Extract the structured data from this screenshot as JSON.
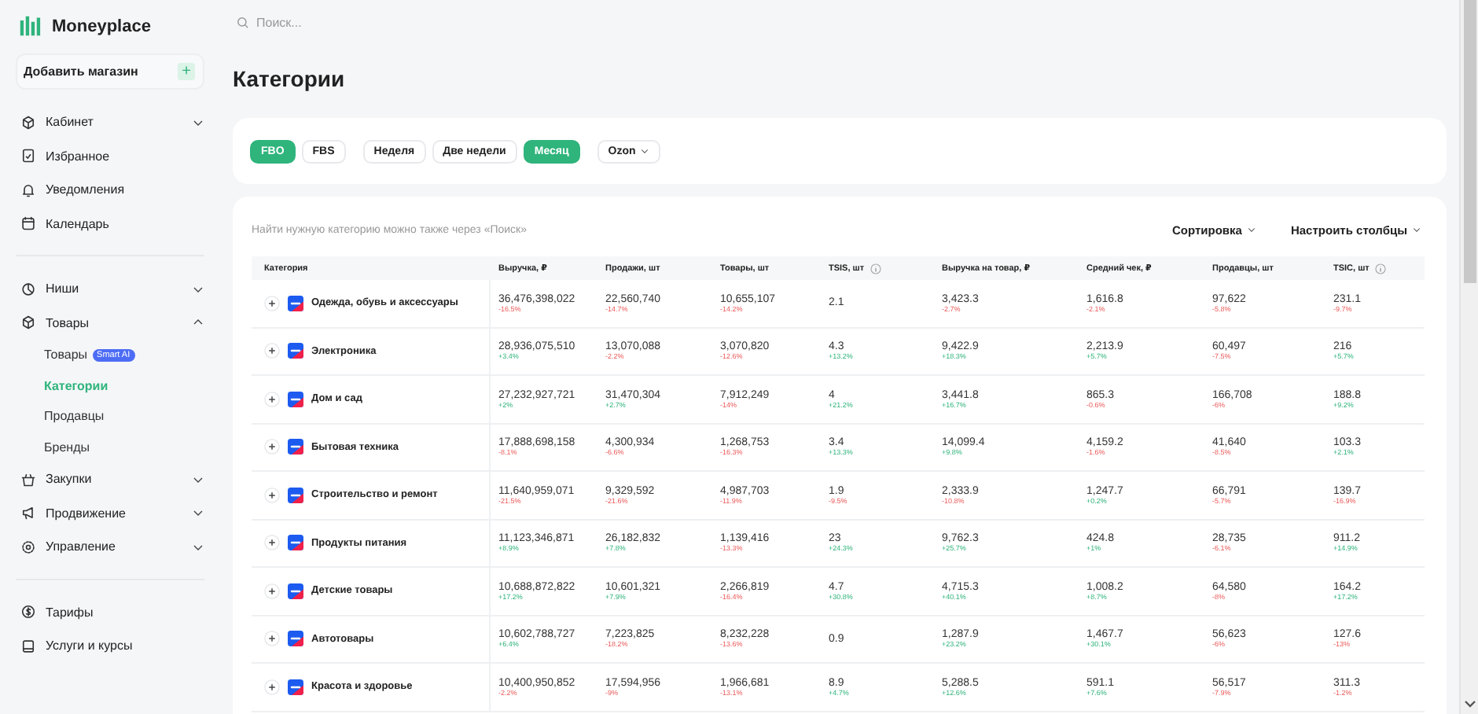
{
  "brand": {
    "name": "Moneyplace"
  },
  "add_store": {
    "label": "Добавить магазин",
    "button": "+"
  },
  "sidebar": {
    "groups": [
      [
        {
          "label": "Кабинет",
          "expanded": false
        },
        {
          "label": "Избранное"
        },
        {
          "label": "Уведомления"
        },
        {
          "label": "Календарь"
        }
      ],
      [
        {
          "label": "Ниши",
          "expanded": false
        },
        {
          "label": "Товары",
          "expanded": true,
          "children": [
            {
              "label": "Товары",
              "badge": "Smart AI",
              "selected": false
            },
            {
              "label": "Категории",
              "selected": true
            },
            {
              "label": "Продавцы",
              "selected": false
            },
            {
              "label": "Бренды",
              "selected": false
            }
          ]
        },
        {
          "label": "Закупки",
          "expanded": false
        },
        {
          "label": "Продвижение",
          "expanded": false
        },
        {
          "label": "Управление",
          "expanded": false
        }
      ],
      [
        {
          "label": "Тарифы"
        },
        {
          "label": "Услуги и курсы"
        }
      ]
    ]
  },
  "search": {
    "placeholder": "Поиск..."
  },
  "page_title": "Категории",
  "filters": [
    {
      "kind": "chip",
      "label": "FBO",
      "selected": true
    },
    {
      "kind": "chip",
      "label": "FBS",
      "selected": false
    },
    {
      "kind": "gap"
    },
    {
      "kind": "chip",
      "label": "Неделя",
      "selected": false
    },
    {
      "kind": "chip",
      "label": "Две недели",
      "selected": false
    },
    {
      "kind": "chip",
      "label": "Месяц",
      "selected": true
    },
    {
      "kind": "gap"
    },
    {
      "kind": "dropdown",
      "label": "Ozon"
    }
  ],
  "hint": "Найти нужную категорию можно также через «Поиск»",
  "toolbar": [
    "Сортировка",
    "Настроить столбцы"
  ],
  "table": {
    "columns": [
      {
        "label": "Категория"
      },
      {
        "label": "Выручка, ₽"
      },
      {
        "label": "Продажи, шт"
      },
      {
        "label": "Товары, шт"
      },
      {
        "label": "TSIS, шт",
        "info": true
      },
      {
        "label": "Выручка на товар, ₽"
      },
      {
        "label": "Средний чек, ₽"
      },
      {
        "label": "Продавцы, шт"
      },
      {
        "label": "TSIC, шт",
        "info": true
      }
    ],
    "rows": [
      {
        "cells": [
          {
            "value": "Одежда, обувь и аксессуары"
          },
          {
            "value": "36,476,398,022",
            "change": "-16.5%",
            "up": false
          },
          {
            "value": "22,560,740",
            "change": "-14.7%",
            "up": false
          },
          {
            "value": "10,655,107",
            "change": "-14.2%",
            "up": false
          },
          {
            "value": "2.1"
          },
          {
            "value": "3,423.3",
            "change": "-2.7%",
            "up": false
          },
          {
            "value": "1,616.8",
            "change": "-2.1%",
            "up": false
          },
          {
            "value": "97,622",
            "change": "-5.8%",
            "up": false
          },
          {
            "value": "231.1",
            "change": "-9.7%",
            "up": false
          }
        ]
      },
      {
        "cells": [
          {
            "value": "Электроника"
          },
          {
            "value": "28,936,075,510",
            "change": "+3.4%",
            "up": true
          },
          {
            "value": "13,070,088",
            "change": "-2.2%",
            "up": false
          },
          {
            "value": "3,070,820",
            "change": "-12.6%",
            "up": false
          },
          {
            "value": "4.3",
            "change": "+13.2%",
            "up": true
          },
          {
            "value": "9,422.9",
            "change": "+18.3%",
            "up": true
          },
          {
            "value": "2,213.9",
            "change": "+5.7%",
            "up": true
          },
          {
            "value": "60,497",
            "change": "-7.5%",
            "up": false
          },
          {
            "value": "216",
            "change": "+5.7%",
            "up": true
          }
        ]
      },
      {
        "cells": [
          {
            "value": "Дом и сад"
          },
          {
            "value": "27,232,927,721",
            "change": "+2%",
            "up": true
          },
          {
            "value": "31,470,304",
            "change": "+2.7%",
            "up": true
          },
          {
            "value": "7,912,249",
            "change": "-14%",
            "up": false
          },
          {
            "value": "4",
            "change": "+21.2%",
            "up": true
          },
          {
            "value": "3,441.8",
            "change": "+16.7%",
            "up": true
          },
          {
            "value": "865.3",
            "change": "-0.6%",
            "up": false
          },
          {
            "value": "166,708",
            "change": "-6%",
            "up": false
          },
          {
            "value": "188.8",
            "change": "+9.2%",
            "up": true
          }
        ]
      },
      {
        "cells": [
          {
            "value": "Бытовая техника"
          },
          {
            "value": "17,888,698,158",
            "change": "-8.1%",
            "up": false
          },
          {
            "value": "4,300,934",
            "change": "-6.6%",
            "up": false
          },
          {
            "value": "1,268,753",
            "change": "-16.3%",
            "up": false
          },
          {
            "value": "3.4",
            "change": "+13.3%",
            "up": true
          },
          {
            "value": "14,099.4",
            "change": "+9.8%",
            "up": true
          },
          {
            "value": "4,159.2",
            "change": "-1.6%",
            "up": false
          },
          {
            "value": "41,640",
            "change": "-8.5%",
            "up": false
          },
          {
            "value": "103.3",
            "change": "+2.1%",
            "up": true
          }
        ]
      },
      {
        "cells": [
          {
            "value": "Строительство и ремонт"
          },
          {
            "value": "11,640,959,071",
            "change": "-21.5%",
            "up": false
          },
          {
            "value": "9,329,592",
            "change": "-21.6%",
            "up": false
          },
          {
            "value": "4,987,703",
            "change": "-11.9%",
            "up": false
          },
          {
            "value": "1.9",
            "change": "-9.5%",
            "up": false
          },
          {
            "value": "2,333.9",
            "change": "-10.8%",
            "up": false
          },
          {
            "value": "1,247.7",
            "change": "+0.2%",
            "up": true
          },
          {
            "value": "66,791",
            "change": "-5.7%",
            "up": false
          },
          {
            "value": "139.7",
            "change": "-16.9%",
            "up": false
          }
        ]
      },
      {
        "cells": [
          {
            "value": "Продукты питания"
          },
          {
            "value": "11,123,346,871",
            "change": "+8.9%",
            "up": true
          },
          {
            "value": "26,182,832",
            "change": "+7.8%",
            "up": true
          },
          {
            "value": "1,139,416",
            "change": "-13.3%",
            "up": false
          },
          {
            "value": "23",
            "change": "+24.3%",
            "up": true
          },
          {
            "value": "9,762.3",
            "change": "+25.7%",
            "up": true
          },
          {
            "value": "424.8",
            "change": "+1%",
            "up": true
          },
          {
            "value": "28,735",
            "change": "-6.1%",
            "up": false
          },
          {
            "value": "911.2",
            "change": "+14.9%",
            "up": true
          }
        ]
      },
      {
        "cells": [
          {
            "value": "Детские товары"
          },
          {
            "value": "10,688,872,822",
            "change": "+17.2%",
            "up": true
          },
          {
            "value": "10,601,321",
            "change": "+7.9%",
            "up": true
          },
          {
            "value": "2,266,819",
            "change": "-16.4%",
            "up": false
          },
          {
            "value": "4.7",
            "change": "+30.8%",
            "up": true
          },
          {
            "value": "4,715.3",
            "change": "+40.1%",
            "up": true
          },
          {
            "value": "1,008.2",
            "change": "+8.7%",
            "up": true
          },
          {
            "value": "64,580",
            "change": "-8%",
            "up": false
          },
          {
            "value": "164.2",
            "change": "+17.2%",
            "up": true
          }
        ]
      },
      {
        "cells": [
          {
            "value": "Автотовары"
          },
          {
            "value": "10,602,788,727",
            "change": "+6.4%",
            "up": true
          },
          {
            "value": "7,223,825",
            "change": "-18.2%",
            "up": false
          },
          {
            "value": "8,232,228",
            "change": "-13.6%",
            "up": false
          },
          {
            "value": "0.9"
          },
          {
            "value": "1,287.9",
            "change": "+23.2%",
            "up": true
          },
          {
            "value": "1,467.7",
            "change": "+30.1%",
            "up": true
          },
          {
            "value": "56,623",
            "change": "-6%",
            "up": false
          },
          {
            "value": "127.6",
            "change": "-13%",
            "up": false
          }
        ]
      },
      {
        "cells": [
          {
            "value": "Красота и здоровье"
          },
          {
            "value": "10,400,950,852",
            "change": "-2.2%",
            "up": false
          },
          {
            "value": "17,594,956",
            "change": "-9%",
            "up": false
          },
          {
            "value": "1,966,681",
            "change": "-13.1%",
            "up": false
          },
          {
            "value": "8.9",
            "change": "+4.7%",
            "up": true
          },
          {
            "value": "5,288.5",
            "change": "+12.6%",
            "up": true
          },
          {
            "value": "591.1",
            "change": "+7.6%",
            "up": true
          },
          {
            "value": "56,517",
            "change": "-7.9%",
            "up": false
          },
          {
            "value": "311.3",
            "change": "-1.2%",
            "up": false
          }
        ]
      }
    ]
  }
}
